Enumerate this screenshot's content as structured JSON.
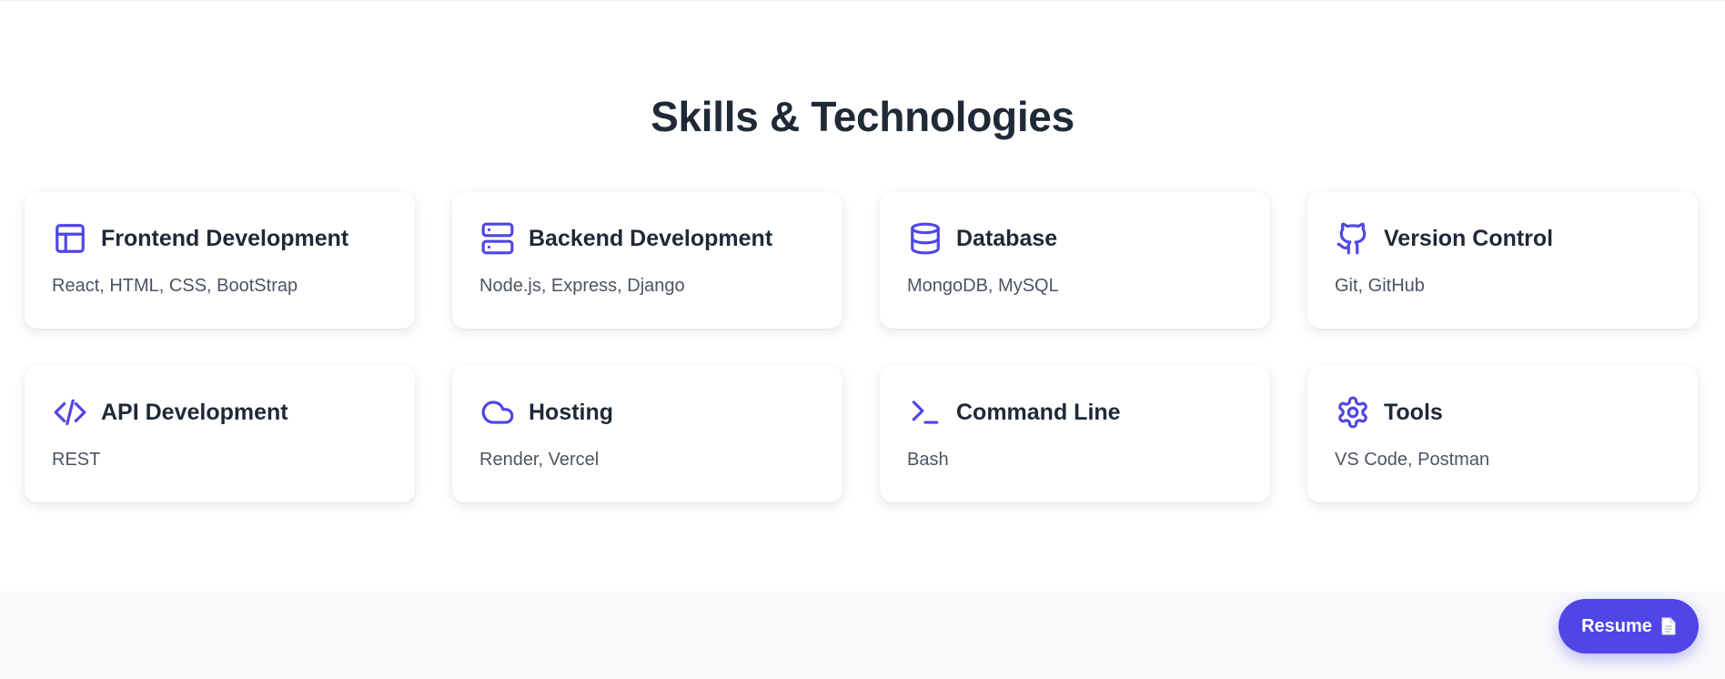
{
  "section": {
    "title": "Skills & Technologies"
  },
  "accent_color": "#4f46e5",
  "skills": [
    {
      "icon": "layout-icon",
      "title": "Frontend Development",
      "items": "React, HTML, CSS, BootStrap"
    },
    {
      "icon": "server-icon",
      "title": "Backend Development",
      "items": "Node.js, Express, Django"
    },
    {
      "icon": "database-icon",
      "title": "Database",
      "items": "MongoDB, MySQL"
    },
    {
      "icon": "github-icon",
      "title": "Version Control",
      "items": "Git, GitHub"
    },
    {
      "icon": "code-icon",
      "title": "API Development",
      "items": "REST"
    },
    {
      "icon": "cloud-icon",
      "title": "Hosting",
      "items": "Render, Vercel"
    },
    {
      "icon": "terminal-icon",
      "title": "Command Line",
      "items": "Bash"
    },
    {
      "icon": "settings-icon",
      "title": "Tools",
      "items": "VS Code, Postman"
    }
  ],
  "resume_button": {
    "label": "Resume",
    "icon": "document-icon"
  }
}
